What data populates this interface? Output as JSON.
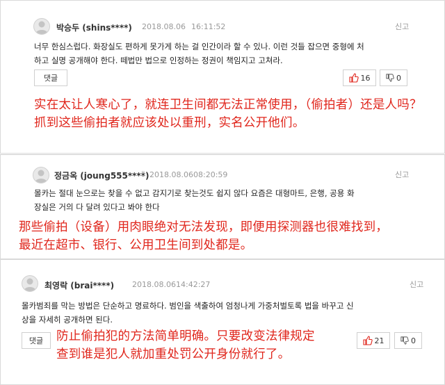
{
  "comments": [
    {
      "username": "박승두 (shins****)",
      "date": "2018.08.06",
      "time": "16:11:52",
      "report_label": "신고",
      "text_lines": [
        "너무 한심스럽다. 화장실도 편하게 못가게 하는 걸 인간이라 할 수 있나. 이런 것들 잡으면 중형에 처",
        "하고 실명 공개해야 한다. 떼법만 법으로 인정하는 정권이 책임지고 고쳐라."
      ],
      "reply_label": "댓글",
      "likes": "16",
      "dislikes": "0",
      "translation_lines": [
        "实在太让人寒心了，就连卫生间都无法正常使用，（偷拍者）还是人吗？",
        "抓到这些偷拍者就应该处以重刑，实名公开他们。"
      ]
    },
    {
      "username": "정금옥 (joung555****)",
      "date": "2018.08.06",
      "time": "08:20:59",
      "report_label": "신고",
      "text_lines": [
        "몰카는 절대 눈으로는 찾을 수 없고 감지기로 찾는것도 쉽지 않다 요즘은 대형마트, 은행, 공용 화",
        "장실은 거의 다 달려 있다고 봐야 한다"
      ],
      "translation_lines": [
        "那些偷拍（设备）用肉眼绝对无法发现，即便用探测器也很难找到，",
        "最近在超市、银行、公用卫生间到处都是。"
      ]
    },
    {
      "username": "최영락 (brai****)",
      "date": "2018.08.06",
      "time": "14:42:27",
      "report_label": "신고",
      "text_lines": [
        "몰카범죄를 막는 방법은 단순하고 명료하다. 범인을 색출하여 엄청나게 가중처벌토록 법을 바꾸고 신",
        "상을 자세히 공개하면 된다."
      ],
      "reply_label": "댓글",
      "likes": "21",
      "dislikes": "0",
      "translation_lines": [
        "防止偷拍犯的方法简单明确。只要改变法律规定",
        "查到谁是犯人就加重处罚公开身份就行了。"
      ]
    }
  ]
}
